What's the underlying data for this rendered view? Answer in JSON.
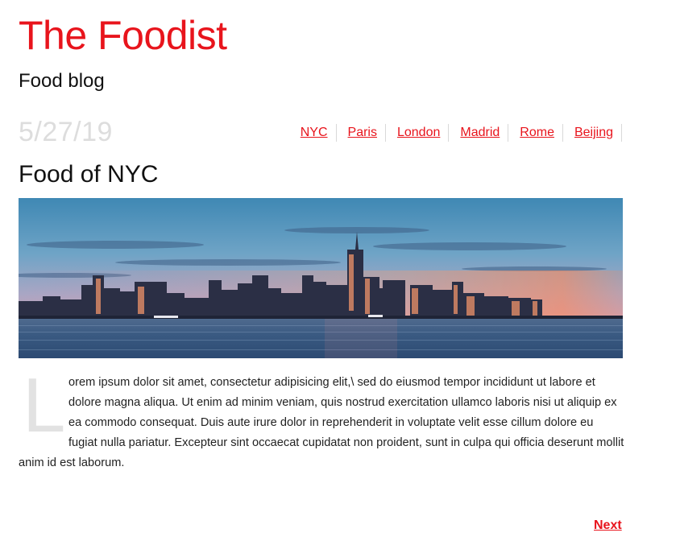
{
  "site": {
    "title": "The Foodist",
    "subtitle": "Food blog"
  },
  "post": {
    "date": "5/27/19",
    "title": "Food of NYC",
    "drop_cap": "L",
    "body": "orem ipsum dolor sit amet, consectetur adipisicing elit,\\ sed do eiusmod tempor incididunt ut labore et dolore magna aliqua. Ut enim ad minim veniam, quis nostrud exercitation ullamco laboris nisi ut aliquip ex ea commodo consequat. Duis aute irure dolor in reprehenderit in voluptate velit esse cillum dolore eu fugiat nulla pariatur. Excepteur sint occaecat cupidatat non proident, sunt in culpa qui officia deserunt mollit anim id est laborum."
  },
  "nav": {
    "items": [
      {
        "label": "NYC"
      },
      {
        "label": "Paris"
      },
      {
        "label": "London"
      },
      {
        "label": "Madrid"
      },
      {
        "label": "Rome"
      },
      {
        "label": "Beijing"
      }
    ]
  },
  "pagination": {
    "next_label": "Next"
  },
  "colors": {
    "brand": "#e8141c",
    "text": "#222222",
    "muted": "#dddddd"
  }
}
